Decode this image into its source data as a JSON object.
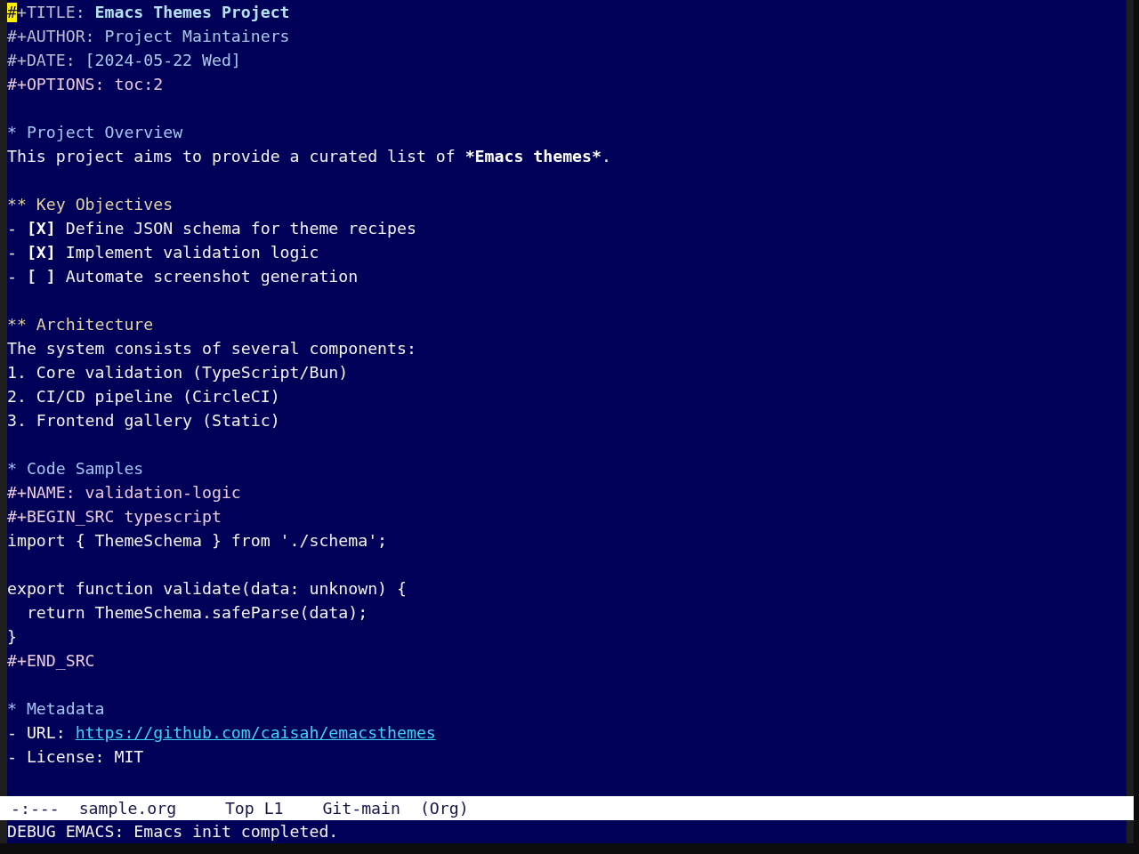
{
  "buffer": {
    "lines": [
      {
        "kind": "title",
        "keyword": "#+TITLE:",
        "value": "Emacs Themes Project",
        "cursor": true
      },
      {
        "kind": "info",
        "keyword": "#+AUTHOR:",
        "value": "Project Maintainers"
      },
      {
        "kind": "info",
        "keyword": "#+DATE:",
        "value": "[2024-05-22 Wed]"
      },
      {
        "kind": "meta",
        "text": "#+OPTIONS: toc:2"
      },
      {
        "kind": "blank"
      },
      {
        "kind": "heading",
        "text": "* Project Overview"
      },
      {
        "kind": "formatted",
        "parts": [
          {
            "text": "This project aims to provide a curated list of ",
            "bold": false
          },
          {
            "text": "*Emacs themes*",
            "bold": true
          },
          {
            "text": ".",
            "bold": false
          }
        ]
      },
      {
        "kind": "blank"
      },
      {
        "kind": "subheading",
        "text": "** Key Objectives"
      },
      {
        "kind": "checkbox",
        "bullet": "-",
        "box": "[X]",
        "checked": true,
        "text": "Define JSON schema for theme recipes"
      },
      {
        "kind": "checkbox",
        "bullet": "-",
        "box": "[X]",
        "checked": true,
        "text": "Implement validation logic"
      },
      {
        "kind": "checkbox",
        "bullet": "-",
        "box": "[ ]",
        "checked": false,
        "text": "Automate screenshot generation"
      },
      {
        "kind": "blank"
      },
      {
        "kind": "subheading",
        "text": "** Architecture"
      },
      {
        "kind": "text",
        "text": "The system consists of several components:"
      },
      {
        "kind": "text",
        "text": "1. Core validation (TypeScript/Bun)"
      },
      {
        "kind": "text",
        "text": "2. CI/CD pipeline (CircleCI)"
      },
      {
        "kind": "text",
        "text": "3. Frontend gallery (Static)"
      },
      {
        "kind": "blank"
      },
      {
        "kind": "heading",
        "text": "* Code Samples"
      },
      {
        "kind": "meta",
        "text": "#+NAME: validation-logic"
      },
      {
        "kind": "meta",
        "text": "#+BEGIN_SRC typescript"
      },
      {
        "kind": "code",
        "text": "import { ThemeSchema } from './schema';"
      },
      {
        "kind": "blank"
      },
      {
        "kind": "code",
        "text": "export function validate(data: unknown) {"
      },
      {
        "kind": "code",
        "text": "  return ThemeSchema.safeParse(data);"
      },
      {
        "kind": "code",
        "text": "}"
      },
      {
        "kind": "meta",
        "text": "#+END_SRC"
      },
      {
        "kind": "blank"
      },
      {
        "kind": "heading",
        "text": "* Metadata"
      },
      {
        "kind": "link",
        "text": "- URL:",
        "link": "https://github.com/caisah/emacsthemes"
      },
      {
        "kind": "text",
        "text": "- License: MIT"
      }
    ]
  },
  "mode_line": {
    "status": "-:---",
    "buffer_name": "sample.org",
    "position": "Top L1",
    "branch": "Git-main",
    "mode": "(Org)"
  },
  "echo_area": {
    "message": "DEBUG EMACS: Emacs init completed."
  }
}
